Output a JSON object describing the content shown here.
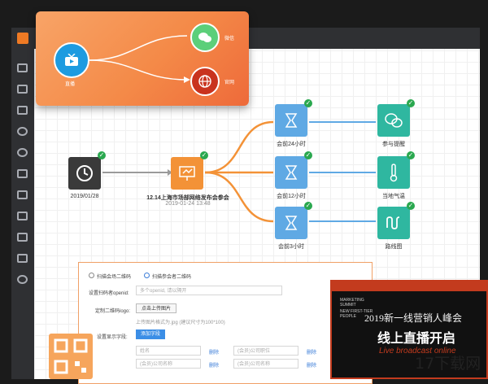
{
  "popup": {
    "source_label": "直播",
    "target_top_label": "微信",
    "target_bottom_label": "官网"
  },
  "flow": {
    "start_node": {
      "label": "2019/01/28"
    },
    "event_node": {
      "label": "12.14上海市场部网络发布会参会",
      "date": "2019-01-24 13:48"
    },
    "wait_nodes": [
      {
        "label": "会前24小时"
      },
      {
        "label": "会前12小时"
      },
      {
        "label": "会前3小时"
      }
    ],
    "action_nodes": [
      {
        "label": "参与提醒"
      },
      {
        "label": "当地气温"
      },
      {
        "label": "路线图"
      }
    ]
  },
  "form": {
    "radio_option_1": "扫描会场二维码",
    "radio_option_2": "扫描参会者二维码",
    "openid_label": "设置扫码者openid:",
    "openid_placeholder": "多个openid, 请以隔开",
    "logo_label": "定制二维码logo:",
    "upload_button": "点击上传图片",
    "upload_hint": "上传图片格式为.jpg (建议尺寸为100*100)",
    "fields_label": "设置显示字段:",
    "add_field_button": "添加字段",
    "field_row_1": {
      "field_a": "姓名",
      "field_b": "(会员)公司职位",
      "delete_a": "删除",
      "delete_b": "删除"
    },
    "field_row_2": {
      "field_a": "(会员)公司名称",
      "field_b": "(会员)公司名称",
      "delete_a": "删除",
      "delete_b": "删除"
    }
  },
  "banner": {
    "small_text_1": "MARKETING SUMMIT",
    "small_text_2": "NEW FIRST-TIER PEOPLE",
    "title": "2019新一线营销人峰会",
    "subtitle": "线上直播开启",
    "english": "Live broadcast online"
  },
  "watermark": "17下载网",
  "colors": {
    "orange": "#f39237",
    "teal": "#2fb7a0",
    "blue_wait": "#5fa9e4",
    "dark_node": "#3a3a3a",
    "check": "#2aa84f"
  }
}
